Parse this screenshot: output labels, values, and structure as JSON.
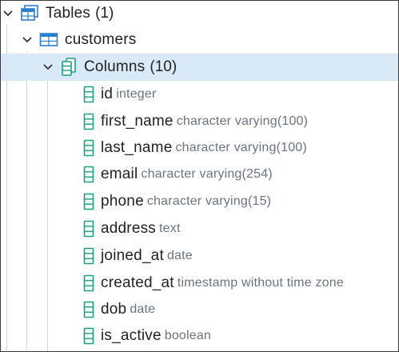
{
  "tree": {
    "tables_node": {
      "label": "Tables",
      "count": "(1)",
      "icon": "tables-icon"
    },
    "table_node": {
      "label": "customers",
      "icon": "table-icon"
    },
    "columns_node": {
      "label": "Columns",
      "count": "(10)",
      "icon": "columns-icon",
      "selected": true
    },
    "columns": [
      {
        "name": "id",
        "type": "integer"
      },
      {
        "name": "first_name",
        "type": "character varying(100)"
      },
      {
        "name": "last_name",
        "type": "character varying(100)"
      },
      {
        "name": "email",
        "type": "character varying(254)"
      },
      {
        "name": "phone",
        "type": "character varying(15)"
      },
      {
        "name": "address",
        "type": "text"
      },
      {
        "name": "joined_at",
        "type": "date"
      },
      {
        "name": "created_at",
        "type": "timestamp without time zone"
      },
      {
        "name": "dob",
        "type": "date"
      },
      {
        "name": "is_active",
        "type": "boolean"
      }
    ]
  },
  "colors": {
    "selection_bg": "#d8eaf8",
    "tables_icon": "#2f7fd1",
    "column_icon": "#1a9e7e",
    "type_text": "#6b7380"
  }
}
